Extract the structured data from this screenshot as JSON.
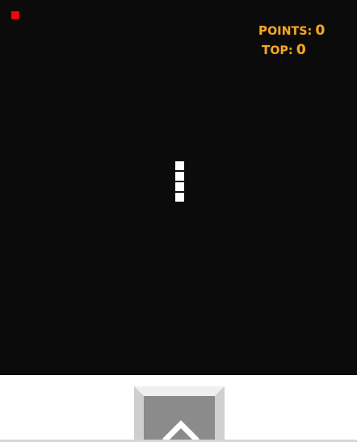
{
  "game": {
    "background_color": "#0b0b0b",
    "food_color": "#ff0000",
    "snake_color": "#ffffff",
    "snake_length": 4,
    "snake_direction": "up"
  },
  "score": {
    "points_label_first": "P",
    "points_label_rest": "OINTS:",
    "points_value": "0",
    "top_label_first": "T",
    "top_label_rest": "OP:",
    "top_value": "0",
    "text_color": "#f5a623"
  },
  "controls": {
    "up_button": {
      "icon": "chevron-up-icon",
      "caption": "..."
    }
  }
}
